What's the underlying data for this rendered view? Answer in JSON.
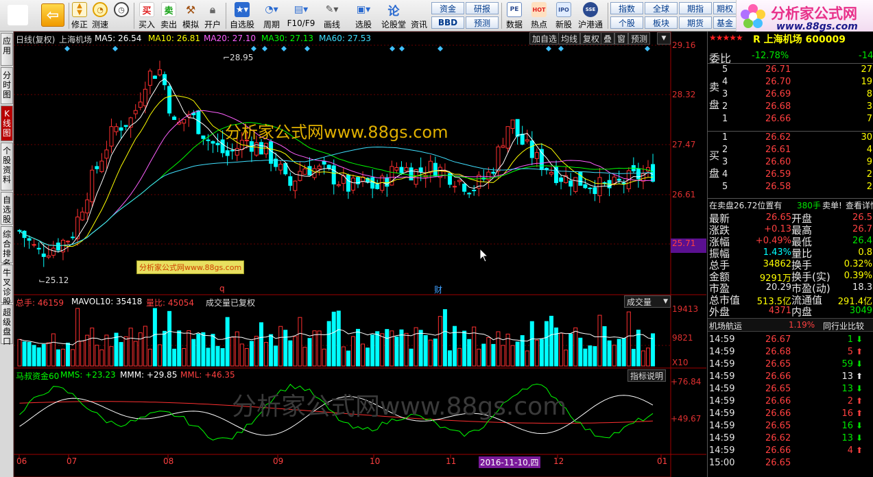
{
  "toolbar": {
    "buttons": [
      "修正",
      "测速",
      "买入",
      "卖出",
      "模拟",
      "开户",
      "自选股",
      "周期",
      "F10/F9",
      "画线",
      "选股",
      "论股堂",
      "资讯",
      "数据",
      "热点",
      "新股",
      "沪港通"
    ],
    "small": [
      "资金",
      "研报",
      "BBD",
      "预测",
      "指数",
      "全球",
      "期指",
      "期权",
      "个股",
      "板块",
      "期货",
      "基金"
    ],
    "icons": {
      "back": "back-arrow-icon",
      "buy": "买",
      "sell": "卖",
      "zixuan": "star-icon",
      "pe": "PE",
      "hot": "HOT",
      "ipo": "IPO",
      "sh": "SSE"
    }
  },
  "logo": {
    "title": "分析家公式网",
    "url": "www.88gs.com"
  },
  "lefttabs": [
    "应用",
    "分时图",
    "K线图",
    "个股资料",
    "自选股",
    "综合排名",
    "牛叉诊股",
    "超级盘口"
  ],
  "chart": {
    "header": {
      "period": "日线(复权)",
      "name": "上海机场",
      "ma5": "MA5: 26.54",
      "ma10": "MA10: 26.81",
      "ma20": "MA20: 27.10",
      "ma30": "MA30: 27.13",
      "ma60": "MA60: 27.53"
    },
    "buttons": [
      "加自选",
      "均线",
      "复权",
      "叠",
      "窗",
      "预测"
    ],
    "price_axis": [
      "29.16",
      "28.32",
      "27.47",
      "26.61",
      "25.71"
    ],
    "high_label": "28.95",
    "low_label": "25.12",
    "watermark": "分析家公式网www.88gs.com",
    "watermark_small": "分析家公式网www.88gs.com",
    "marker_q": "q",
    "marker_cai": "财",
    "vol_header": {
      "total": "总手: 46159",
      "mavol": "MAVOL10: 35418",
      "ratio": "量比: 45054",
      "note": "成交量已复权"
    },
    "vol_dropdown": "成交量",
    "vol_axis": [
      "19413",
      "9821",
      "X10"
    ],
    "ind_header": {
      "name": "马叔资金60",
      "mms": "MMS: +23.23",
      "mmm": "MMM: +29.85",
      "mml": "MML: +46.35"
    },
    "ind_button": "指标说明",
    "ind_axis": [
      "+76.84",
      "+49.67"
    ],
    "bottom_watermark": "分析家公式网www.88gs.com",
    "months": [
      "06",
      "07",
      "08",
      "09",
      "10",
      "11",
      "12",
      "01"
    ],
    "cursor_date": "2016-11-10,四"
  },
  "panel": {
    "stock": "R 上海机场 600009",
    "weibi_label": "委比",
    "weibi_value": "-12.78%",
    "weibi_right": "-14",
    "sell_label": "卖盘",
    "buy_label": "买盘",
    "sell": [
      {
        "n": "5",
        "p": "26.71",
        "v": "27"
      },
      {
        "n": "4",
        "p": "26.70",
        "v": "19"
      },
      {
        "n": "3",
        "p": "26.69",
        "v": "8"
      },
      {
        "n": "2",
        "p": "26.68",
        "v": "3"
      },
      {
        "n": "1",
        "p": "26.66",
        "v": "7"
      }
    ],
    "buy": [
      {
        "n": "1",
        "p": "26.62",
        "v": "30"
      },
      {
        "n": "2",
        "p": "26.61",
        "v": "4"
      },
      {
        "n": "3",
        "p": "26.60",
        "v": "9"
      },
      {
        "n": "4",
        "p": "26.59",
        "v": "2"
      },
      {
        "n": "5",
        "p": "26.58",
        "v": "2"
      }
    ],
    "notice": {
      "text": "在卖盘26.72位置有",
      "hands": "380手",
      "action": "卖单!",
      "link": "查看详情"
    },
    "stats": [
      {
        "l": "最新",
        "v": "26.65",
        "l2": "开盘",
        "v2": "26.5"
      },
      {
        "l": "涨跌",
        "v": "+0.13",
        "l2": "最高",
        "v2": "26.7"
      },
      {
        "l": "涨幅",
        "v": "+0.49%",
        "l2": "最低",
        "v2": "26.4"
      },
      {
        "l": "振幅",
        "v": "1.43%",
        "l2": "量比",
        "v2": "0.8"
      },
      {
        "l": "总手",
        "v": "34862",
        "l2": "换手",
        "v2": "0.32%"
      },
      {
        "l": "金额",
        "v": "9291万",
        "l2": "换手(实)",
        "v2": "0.39%"
      },
      {
        "l": "市盈",
        "v": "20.29",
        "l2": "市盈(动)",
        "v2": "18.3"
      },
      {
        "l": "总市值",
        "v": "513.5亿",
        "l2": "流通值",
        "v2": "291.4亿"
      },
      {
        "l": "外盘",
        "v": "4371",
        "l2": "内盘",
        "v2": "3049"
      }
    ],
    "sector": {
      "name": "机场航运",
      "pct": "1.19%",
      "compare": "同行业比较"
    },
    "ticks": [
      {
        "t": "14:59",
        "p": "26.67",
        "v": "1",
        "d": "down"
      },
      {
        "t": "14:59",
        "p": "26.68",
        "v": "5",
        "d": "up"
      },
      {
        "t": "14:59",
        "p": "26.65",
        "v": "59",
        "d": "down"
      },
      {
        "t": "14:59",
        "p": "26.66",
        "v": "13",
        "d": "upw"
      },
      {
        "t": "14:59",
        "p": "26.65",
        "v": "13",
        "d": "down"
      },
      {
        "t": "14:59",
        "p": "26.66",
        "v": "2",
        "d": "up"
      },
      {
        "t": "14:59",
        "p": "26.66",
        "v": "16",
        "d": "up"
      },
      {
        "t": "14:59",
        "p": "26.65",
        "v": "16",
        "d": "down"
      },
      {
        "t": "14:59",
        "p": "26.62",
        "v": "13",
        "d": "down"
      },
      {
        "t": "14:59",
        "p": "26.66",
        "v": "4",
        "d": "up"
      },
      {
        "t": "15:00",
        "p": "26.65",
        "v": "",
        "d": "none"
      }
    ]
  },
  "colors": {
    "up": "#ff3030",
    "down": "#00ffff",
    "ma5": "#ffffff",
    "ma10": "#ffff00",
    "ma20": "#ff60ff",
    "ma30": "#00ff00",
    "ma60": "#40e0ff"
  }
}
